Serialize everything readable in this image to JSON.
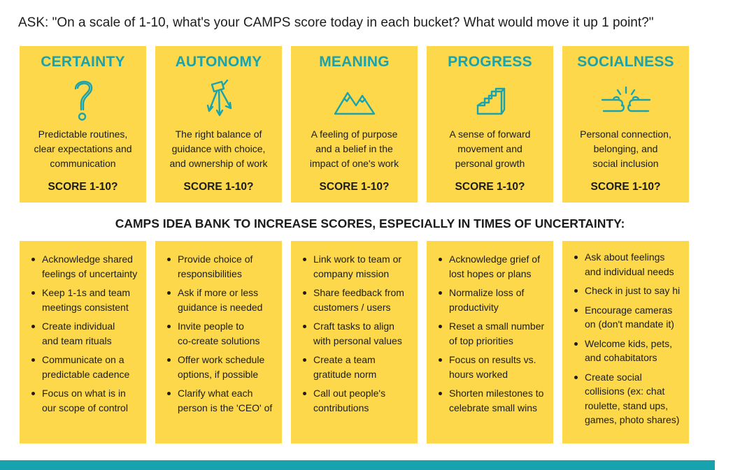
{
  "ask_prompt": "ASK: \"On a scale of 1-10, what's your CAMPS score today in each bucket? What would move it up 1 point?\"",
  "accent_color": "#1aa3ad",
  "card_color": "#fcd84a",
  "buckets": [
    {
      "title": "CERTAINTY",
      "icon": "question-mark-icon",
      "description": "Predictable routines,\nclear expectations and\ncommunication",
      "score_label": "SCORE 1-10?"
    },
    {
      "title": "AUTONOMY",
      "icon": "branching-arrows-icon",
      "description": "The right balance of\nguidance with choice,\nand ownership of work",
      "score_label": "SCORE 1-10?"
    },
    {
      "title": "MEANING",
      "icon": "mountains-icon",
      "description": "A feeling of purpose\nand a belief in the\nimpact of one's work",
      "score_label": "SCORE 1-10?"
    },
    {
      "title": "PROGRESS",
      "icon": "stairs-icon",
      "description": "A sense of forward\nmovement and\npersonal growth",
      "score_label": "SCORE 1-10?"
    },
    {
      "title": "SOCIALNESS",
      "icon": "fist-bump-icon",
      "description": "Personal connection,\nbelonging, and\nsocial inclusion",
      "score_label": "SCORE 1-10?"
    }
  ],
  "idea_bank_heading": "CAMPS IDEA BANK TO INCREASE SCORES, ESPECIALLY IN TIMES OF UNCERTAINTY:",
  "idea_banks": [
    {
      "items": [
        "Acknowledge shared\nfeelings of uncertainty",
        "Keep 1-1s and team\nmeetings consistent",
        "Create individual\n and team rituals",
        "Communicate on a\npredictable cadence",
        "Focus on what is in\nour scope of control"
      ]
    },
    {
      "items": [
        "Provide choice of\nresponsibilities",
        "Ask if more or less\nguidance is needed",
        "Invite people to\n co-create solutions",
        "Offer work schedule\noptions, if possible",
        "Clarify what each\nperson is the 'CEO' of"
      ]
    },
    {
      "items": [
        "Link work to team or\ncompany mission",
        "Share feedback from\ncustomers / users",
        "Craft tasks to align\nwith personal values",
        "Create a team\ngratitude norm",
        "Call out people's\ncontributions"
      ]
    },
    {
      "items": [
        "Acknowledge grief of\nlost hopes or plans",
        "Normalize loss of\nproductivity",
        "Reset a small number\nof top priorities",
        "Focus on results vs.\nhours worked",
        "Shorten milestones to\ncelebrate small wins"
      ]
    },
    {
      "items": [
        "Ask about feelings\nand individual needs",
        "Check in just to say hi",
        "Encourage cameras\non (don't mandate it)",
        "Welcome kids, pets,\nand cohabitators",
        "Create social\ncollisions (ex: chat\nroulette, stand ups,\ngames, photo shares)"
      ]
    }
  ]
}
